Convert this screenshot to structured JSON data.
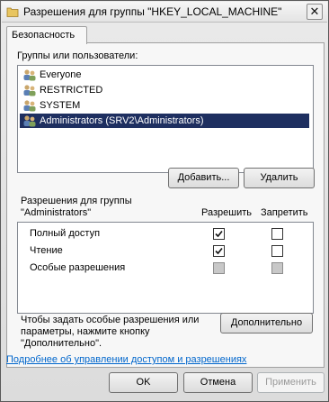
{
  "window": {
    "title": "Разрешения для группы \"HKEY_LOCAL_MACHINE\"",
    "close_label": "✕"
  },
  "tabs": [
    {
      "label": "Безопасность"
    }
  ],
  "groups": {
    "heading": "Группы или пользователи:",
    "items": [
      {
        "label": "Everyone",
        "selected": false
      },
      {
        "label": "RESTRICTED",
        "selected": false
      },
      {
        "label": "SYSTEM",
        "selected": false
      },
      {
        "label": "Administrators (SRV2\\Administrators)",
        "selected": true
      }
    ],
    "add_label": "Добавить...",
    "remove_label": "Удалить"
  },
  "permissions": {
    "heading_line1": "Разрешения для группы",
    "heading_line2": "\"Administrators\"",
    "allow_header": "Разрешить",
    "deny_header": "Запретить",
    "rows": [
      {
        "label": "Полный доступ",
        "allow": "checked",
        "deny": "unchecked"
      },
      {
        "label": "Чтение",
        "allow": "checked",
        "deny": "unchecked"
      },
      {
        "label": "Особые разрешения",
        "allow": "disabled",
        "deny": "disabled"
      }
    ]
  },
  "advanced": {
    "text_line1": "Чтобы задать особые разрешения или",
    "text_line2": "параметры, нажмите кнопку",
    "text_line3": "\"Дополнительно\".",
    "button_label": "Дополнительно"
  },
  "link_text": "Подробнее об управлении доступом и разрешениях",
  "footer": {
    "ok_label": "OK",
    "cancel_label": "Отмена",
    "apply_label": "Применить"
  },
  "colors": {
    "selection": "#1e2f60",
    "link": "#0066cc"
  }
}
